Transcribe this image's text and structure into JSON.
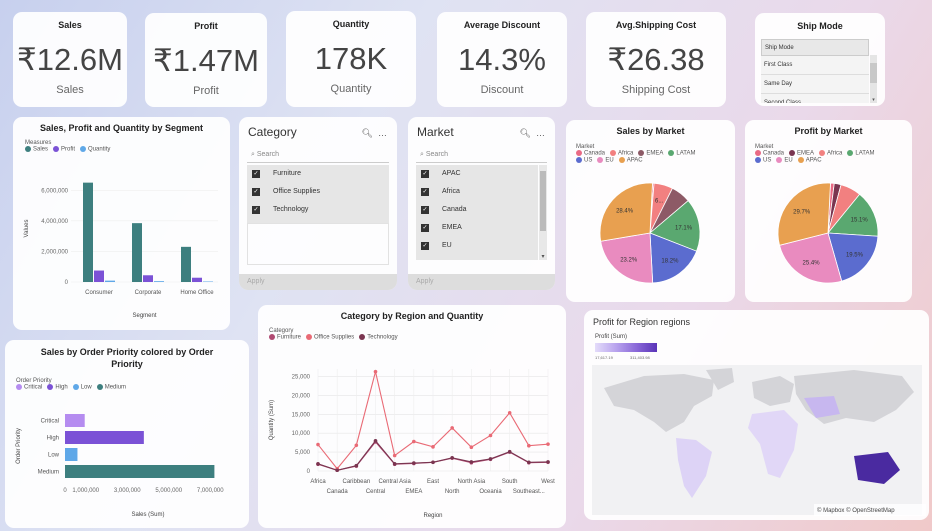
{
  "kpis": [
    {
      "title": "Sales",
      "value": "₹12.6M",
      "sub": "Sales"
    },
    {
      "title": "Profit",
      "value": "₹1.47M",
      "sub": "Profit"
    },
    {
      "title": "Quantity",
      "value": "178K",
      "sub": "Quantity"
    },
    {
      "title": "Average Discount",
      "value": "14.3%",
      "sub": "Discount"
    },
    {
      "title": "Avg.Shipping Cost",
      "value": "₹26.38",
      "sub": "Shipping Cost"
    }
  ],
  "ship_mode": {
    "title": "Ship Mode",
    "items": [
      "Ship Mode",
      "First Class",
      "Same Day",
      "Second Class"
    ]
  },
  "category_slicer": {
    "title": "Category",
    "search": "Search",
    "items": [
      "Furniture",
      "Office Supplies",
      "Technology"
    ],
    "apply": "Apply"
  },
  "market_slicer": {
    "title": "Market",
    "search": "Search",
    "items": [
      "APAC",
      "Africa",
      "Canada",
      "EMEA",
      "EU"
    ],
    "apply": "Apply"
  },
  "icons": {
    "search": "search-icon",
    "more": "more-icon"
  },
  "map": {
    "title": "Profit for Region regions",
    "legend_title": "Profit (Sum)",
    "min": "17,617.19",
    "max": "311,403.98",
    "attribution": "© Mapbox © OpenStreetMap"
  },
  "colors": {
    "teal": "#3d7f7f",
    "purple": "#7b52d6",
    "blue": "#5fa8e8",
    "pink": "#e96a85",
    "dark_rose": "#7a3550"
  },
  "chart_data": [
    {
      "type": "bar",
      "title": "Sales, Profit and Quantity by Segment",
      "legend_title": "Measures",
      "categories": [
        "Consumer",
        "Corporate",
        "Home Office"
      ],
      "series": [
        {
          "name": "Sales",
          "values": [
            6500000,
            3850000,
            2300000
          ],
          "color": "#3d7f7f"
        },
        {
          "name": "Profit",
          "values": [
            750000,
            440000,
            280000
          ],
          "color": "#7b52d6"
        },
        {
          "name": "Quantity",
          "values": [
            90000,
            55000,
            33000
          ],
          "color": "#5fa8e8"
        }
      ],
      "xlabel": "Segment",
      "ylabel": "Values",
      "ylim": [
        0,
        7000000
      ],
      "yticks": [
        "0",
        "2,000,000",
        "4,000,000",
        "6,000,000"
      ]
    },
    {
      "type": "bar",
      "title": "Sales by Order Priority colored by Order Priority",
      "legend_title": "Order Priority",
      "orientation": "horizontal",
      "categories": [
        "Critical",
        "High",
        "Low",
        "Medium"
      ],
      "legend": [
        {
          "name": "Critical",
          "color": "#b58cf0"
        },
        {
          "name": "High",
          "color": "#7b52d6"
        },
        {
          "name": "Low",
          "color": "#5fa8e8"
        },
        {
          "name": "Medium",
          "color": "#3d7f7f"
        }
      ],
      "values": [
        950000,
        3800000,
        600000,
        7200000
      ],
      "xlabel": "Sales (Sum)",
      "ylabel": "Order Priority",
      "xlim": [
        0,
        8000000
      ],
      "xticks": [
        "0",
        "1,000,000",
        "3,000,000",
        "5,000,000",
        "7,000,000"
      ]
    },
    {
      "type": "line",
      "title": "Category by Region and Quantity",
      "legend_title": "Category",
      "categories": [
        "Africa",
        "Canada",
        "Caribbean",
        "Central",
        "Central Asia",
        "EMEA",
        "East",
        "North",
        "North Asia",
        "Oceania",
        "South",
        "Southeast...",
        "West"
      ],
      "xtick_row1": [
        "Africa",
        "Caribbean",
        "Central Asia",
        "East",
        "North Asia",
        "South",
        "West"
      ],
      "xtick_row2": [
        "Canada",
        "Central",
        "EMEA",
        "North",
        "Oceania",
        "Southeast..."
      ],
      "series": [
        {
          "name": "Furniture",
          "values": [
            1800,
            200,
            1300,
            7700,
            1800,
            2000,
            2300,
            3400,
            2200,
            3100,
            5000,
            2200,
            2300
          ],
          "color": "#b04a72"
        },
        {
          "name": "Office Supplies",
          "values": [
            7000,
            600,
            6800,
            26300,
            4100,
            7800,
            6400,
            11400,
            6300,
            9400,
            15400,
            6700,
            7100
          ],
          "color": "#e96a75"
        },
        {
          "name": "Technology",
          "values": [
            1900,
            200,
            1400,
            8000,
            1900,
            2100,
            2300,
            3500,
            2400,
            3200,
            5100,
            2300,
            2400
          ],
          "color": "#7a3550"
        }
      ],
      "xlabel": "Region",
      "ylabel": "Quantity (Sum)",
      "ylim": [
        0,
        27000
      ],
      "yticks": [
        "0",
        "5,000",
        "10,000",
        "15,000",
        "20,000",
        "25,000"
      ]
    },
    {
      "type": "pie",
      "title": "Sales by Market",
      "legend_title": "Market",
      "legend": [
        {
          "name": "Canada",
          "color": "#e96a85"
        },
        {
          "name": "Africa",
          "color": "#f28080"
        },
        {
          "name": "EMEA",
          "color": "#8d5a66"
        },
        {
          "name": "LATAM",
          "color": "#5aa870"
        },
        {
          "name": "US",
          "color": "#5b6ccf"
        },
        {
          "name": "EU",
          "color": "#e98bbf"
        },
        {
          "name": "APAC",
          "color": "#e8a050"
        }
      ],
      "slices": [
        {
          "name": "Canada",
          "value": 0.5,
          "color": "#e96a85"
        },
        {
          "name": "Africa",
          "value": 6.1,
          "color": "#f28080",
          "label": "6..."
        },
        {
          "name": "EMEA",
          "value": 6.4,
          "color": "#8d5a66"
        },
        {
          "name": "LATAM",
          "value": 17.1,
          "color": "#5aa870",
          "label": "17.1%"
        },
        {
          "name": "US",
          "value": 18.2,
          "color": "#5b6ccf",
          "label": "18.2%"
        },
        {
          "name": "EU",
          "value": 23.2,
          "color": "#e98bbf",
          "label": "23.2%"
        },
        {
          "name": "APAC",
          "value": 28.4,
          "color": "#e8a050",
          "label": "28.4%"
        }
      ]
    },
    {
      "type": "pie",
      "title": "Profit by Market",
      "legend_title": "Market",
      "legend": [
        {
          "name": "Canada",
          "color": "#e96a85"
        },
        {
          "name": "EMEA",
          "color": "#7a3550"
        },
        {
          "name": "Africa",
          "color": "#f28080"
        },
        {
          "name": "LATAM",
          "color": "#5aa870"
        },
        {
          "name": "US",
          "color": "#5b6ccf"
        },
        {
          "name": "EU",
          "color": "#e98bbf"
        },
        {
          "name": "APAC",
          "color": "#e8a050"
        }
      ],
      "slices": [
        {
          "name": "Canada",
          "value": 1.2,
          "color": "#e96a85"
        },
        {
          "name": "EMEA",
          "value": 2.2,
          "color": "#7a3550"
        },
        {
          "name": "Africa",
          "value": 6.7,
          "color": "#f28080"
        },
        {
          "name": "LATAM",
          "value": 15.1,
          "color": "#5aa870",
          "label": "15.1%"
        },
        {
          "name": "US",
          "value": 19.5,
          "color": "#5b6ccf",
          "label": "19.5%"
        },
        {
          "name": "EU",
          "value": 25.4,
          "color": "#e98bbf",
          "label": "25.4%"
        },
        {
          "name": "APAC",
          "value": 29.7,
          "color": "#e8a050",
          "label": "29.7%"
        }
      ]
    }
  ]
}
